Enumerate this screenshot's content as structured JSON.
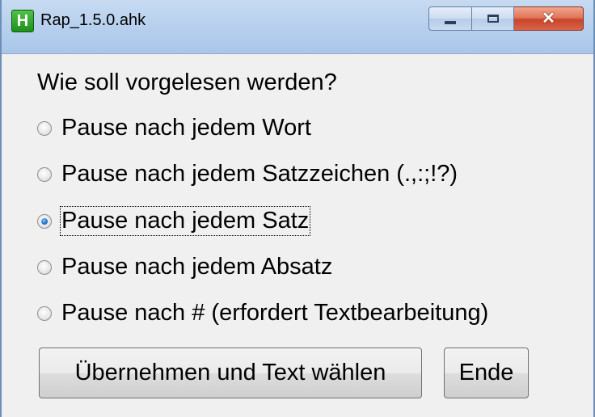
{
  "window": {
    "title": "Rap_1.5.0.ahk",
    "icon_letter": "H",
    "controls": [
      "minimize",
      "maximize",
      "close"
    ]
  },
  "prompt": "Wie soll vorgelesen werden?",
  "options": [
    {
      "label": "Pause nach jedem Wort",
      "checked": false
    },
    {
      "label": "Pause nach jedem Satzzeichen (.,:;!?)",
      "checked": false
    },
    {
      "label": "Pause nach jedem Satz",
      "checked": true
    },
    {
      "label": "Pause nach jedem Absatz",
      "checked": false
    },
    {
      "label": "Pause nach # (erfordert Textbearbeitung)",
      "checked": false
    }
  ],
  "buttons": {
    "apply_label": "Übernehmen und Text wählen",
    "end_label": "Ende"
  }
}
